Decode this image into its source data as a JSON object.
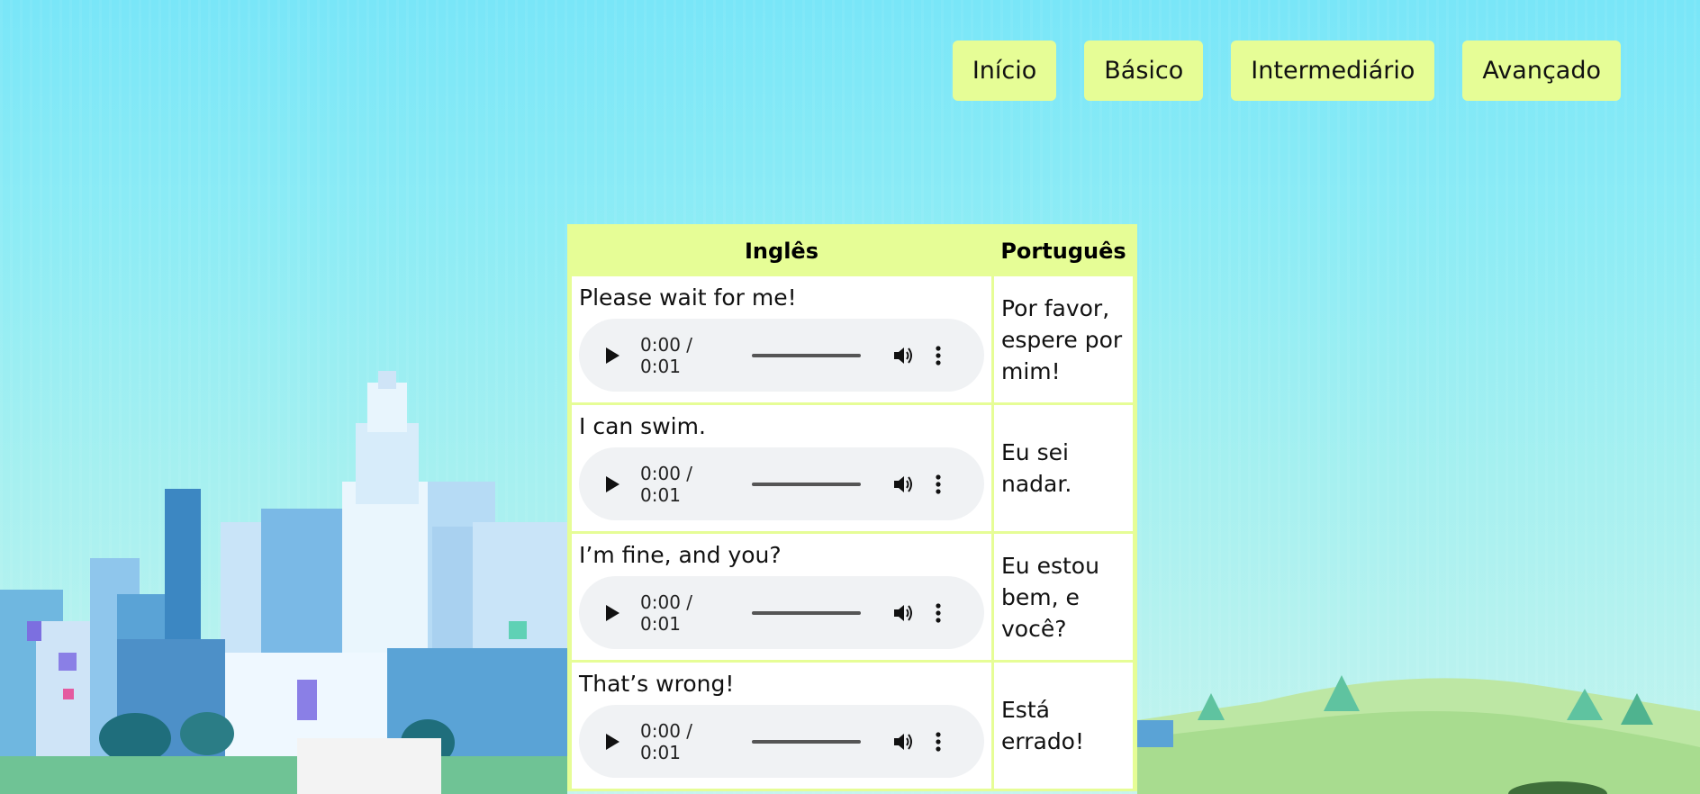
{
  "nav": {
    "items": [
      {
        "label": "Início"
      },
      {
        "label": "Básico"
      },
      {
        "label": "Intermediário"
      },
      {
        "label": "Avançado"
      }
    ]
  },
  "table": {
    "headers": {
      "english": "Inglês",
      "portuguese": "Português"
    },
    "rows": [
      {
        "english": "Please wait for me!",
        "portuguese": "Por favor, espere por mim!",
        "time": "0:00 / 0:01"
      },
      {
        "english": "I can swim.",
        "portuguese": "Eu sei nadar.",
        "time": "0:00 / 0:01"
      },
      {
        "english": "I’m fine, and you?",
        "portuguese": "Eu estou bem, e você?",
        "time": "0:00 / 0:01"
      },
      {
        "english": "That’s wrong!",
        "portuguese": "Está errado!",
        "time": "0:00 / 0:01"
      }
    ]
  },
  "icons": {
    "play": "play-icon",
    "volume": "volume-icon",
    "more": "more-vertical-icon"
  },
  "colors": {
    "accent": "#e6fd96",
    "sky": "#79e6f8",
    "player_bg": "#f0f2f4"
  }
}
